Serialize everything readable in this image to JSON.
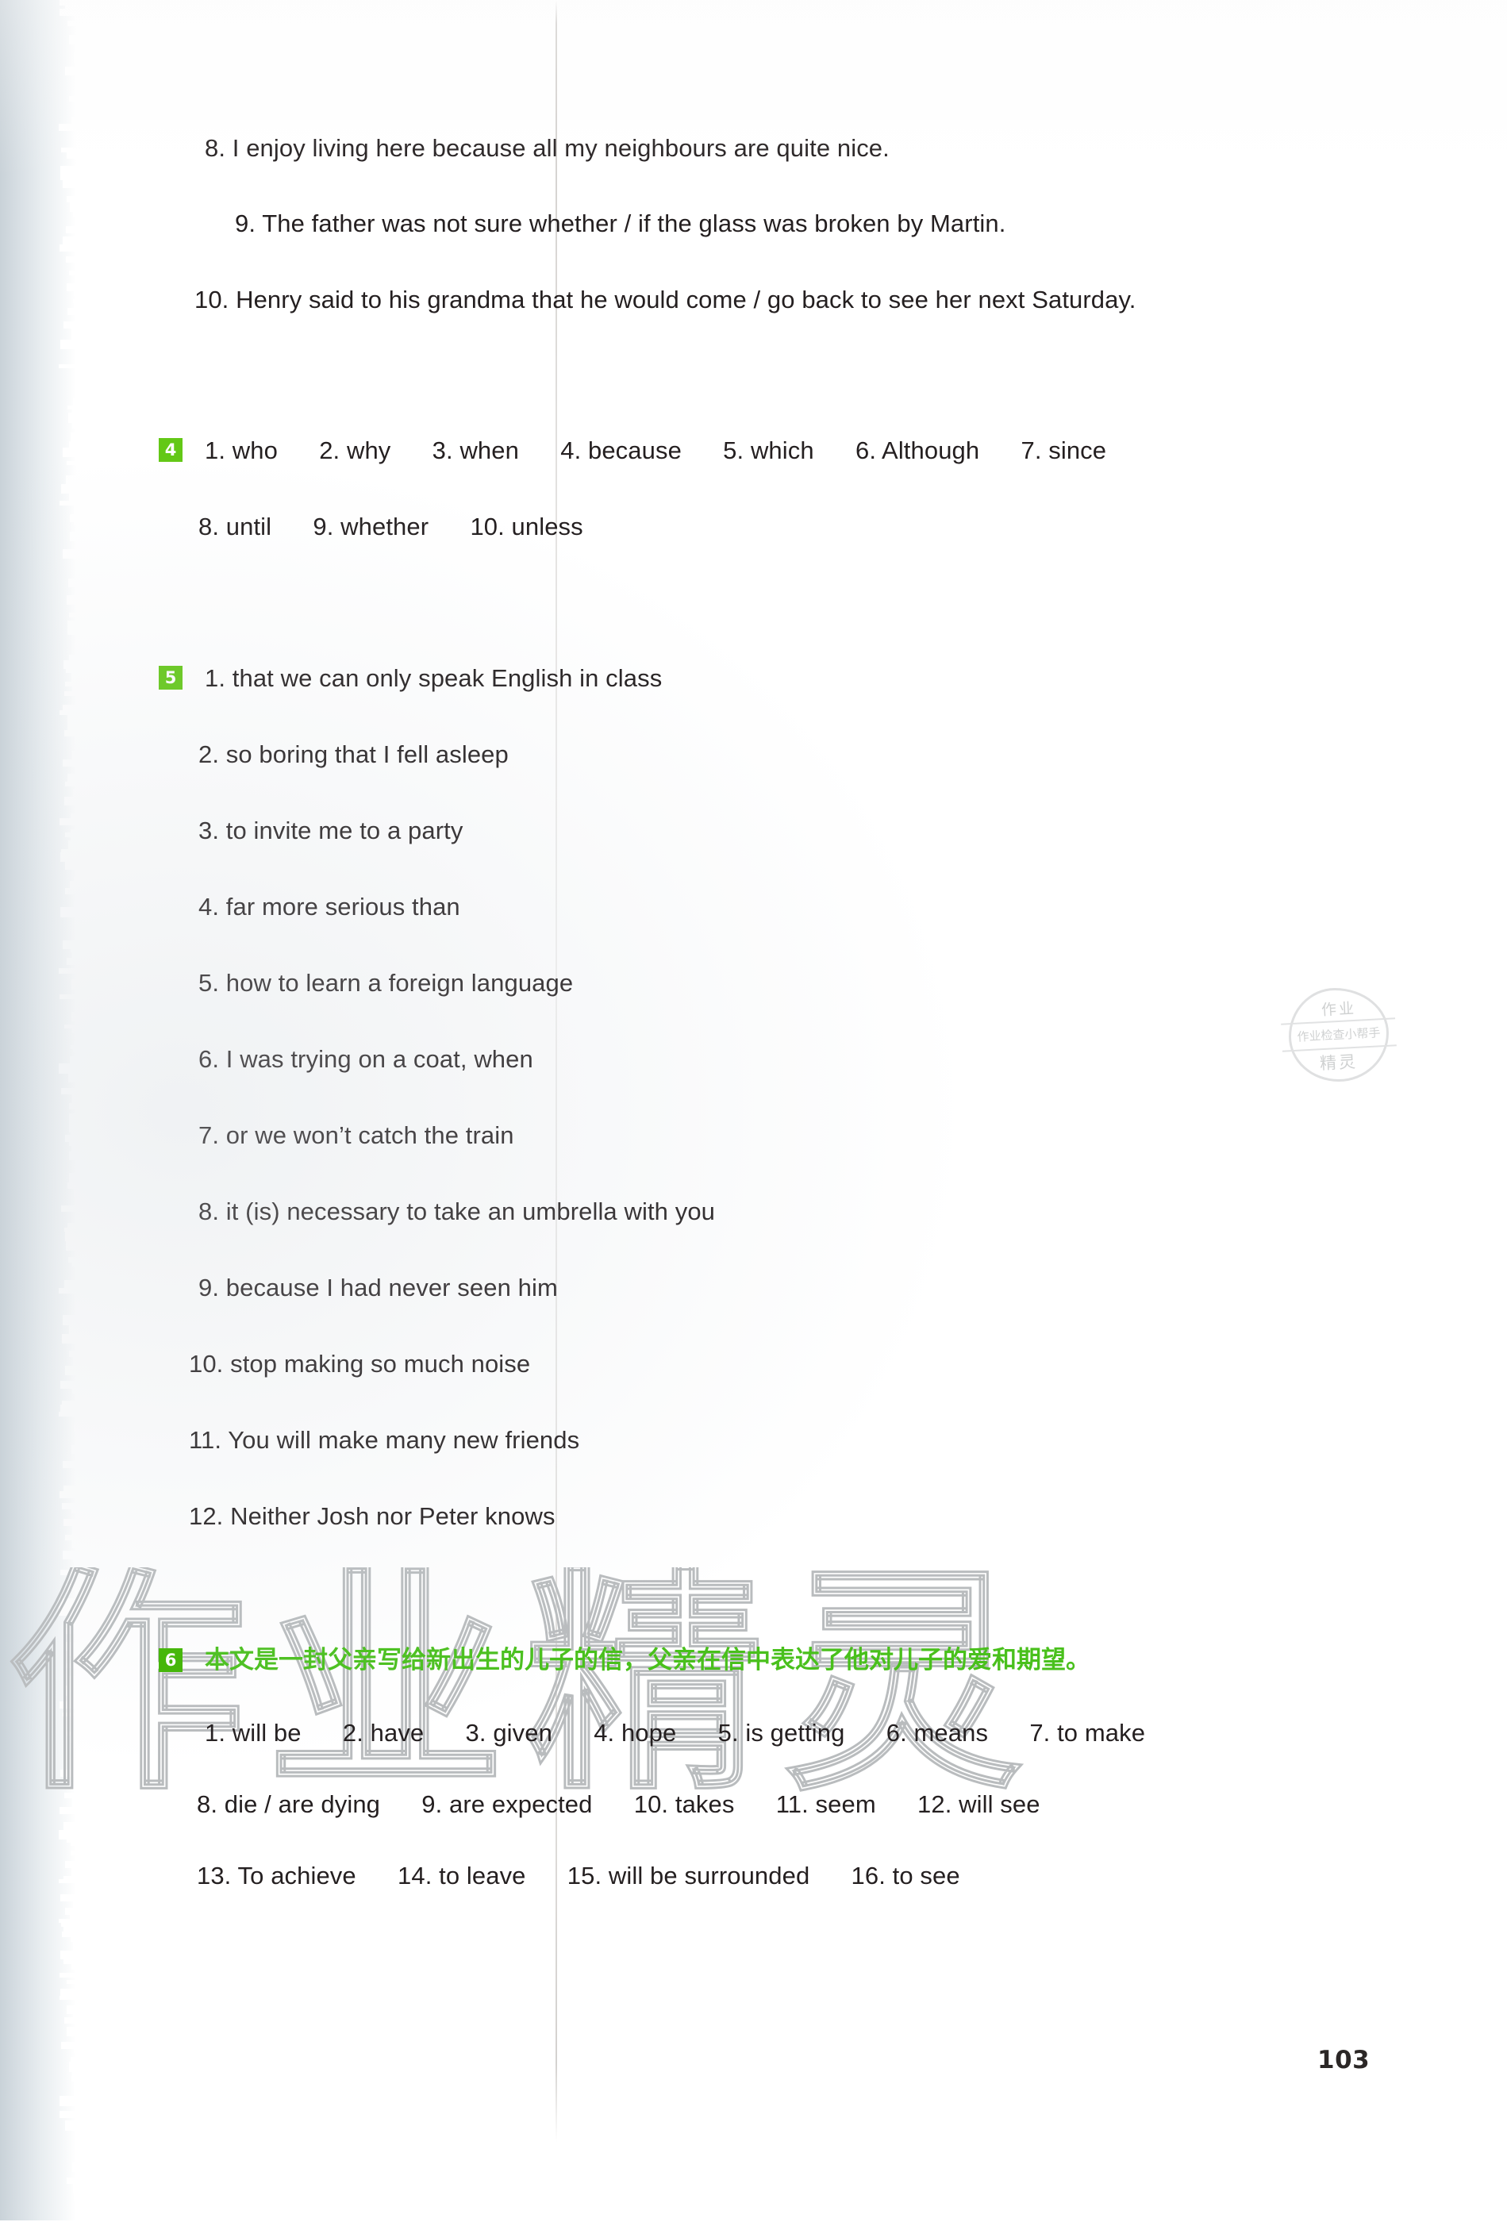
{
  "page": {
    "number": "103",
    "watermark_text": "作业精灵",
    "seal": {
      "top": "作业",
      "middle": "作业检查小帮手",
      "bottom": "精灵"
    }
  },
  "continued_exercise": {
    "items": [
      "8. I enjoy living here because all my neighbours are quite nice.",
      "9. The father was not sure whether / if the glass was broken by Martin.",
      "10. Henry said to his grandma that he would come / go back to see her next Saturday."
    ]
  },
  "sections": [
    {
      "badge": "4",
      "lines": [
        "1. who      2. why      3. when      4. because      5. which      6. Although      7. since",
        "8. until      9. whether      10. unless"
      ]
    },
    {
      "badge": "5",
      "lines": [
        "1. that we can only speak English in class",
        "2. so boring that I fell asleep",
        "3. to invite me to a party",
        "4. far more serious than",
        "5. how to learn a foreign language",
        "6. I was trying on a coat, when",
        "7. or we won’t catch the train",
        "8. it (is) necessary to take an umbrella with you",
        "9. because I had never seen him",
        "10. stop making so much noise",
        "11. You will make many new friends",
        "12. Neither Josh nor Peter knows"
      ]
    },
    {
      "badge": "6",
      "note": "本文是一封父亲写给新出生的儿子的信，父亲在信中表达了他对儿子的爱和期望。",
      "lines": [
        "1. will be      2. have      3. given      4. hope      5. is getting      6. means      7. to make",
        "8. die / are dying      9. are expected      10. takes      11. seem      12. will see",
        "13. To achieve      14. to leave      15. will be surrounded      16. to see"
      ]
    }
  ],
  "colors": {
    "badge_green": "#63c816",
    "note_green": "#49c01c",
    "ink": "#231f20"
  }
}
